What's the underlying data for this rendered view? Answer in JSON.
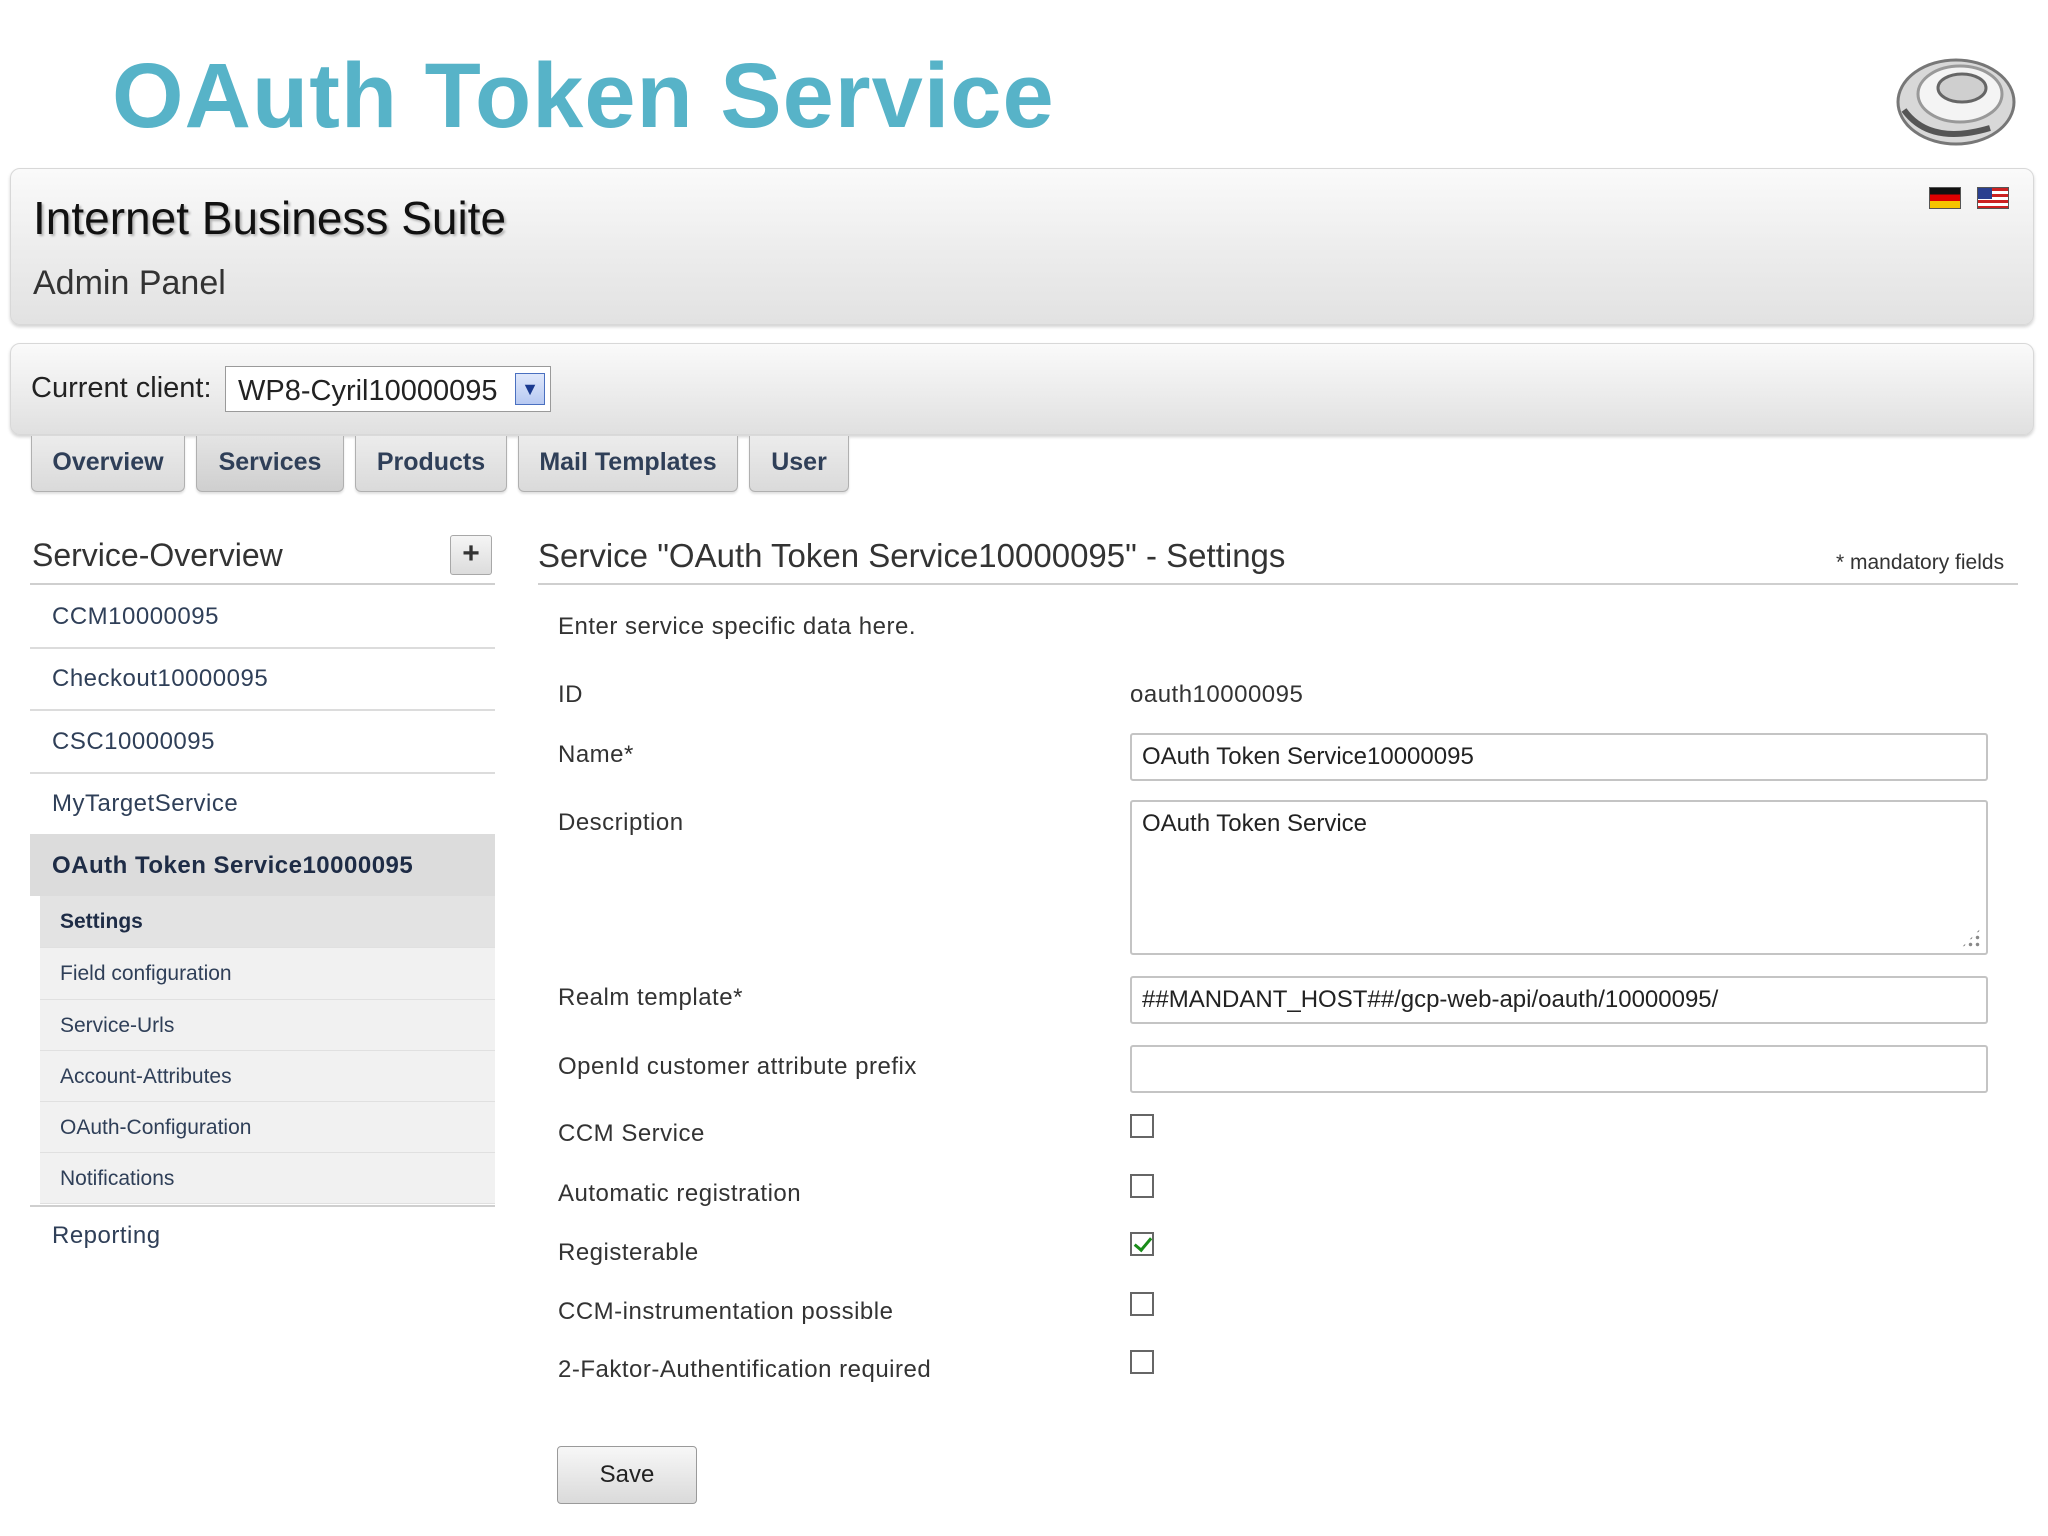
{
  "slide": {
    "title": "OAuth Token Service"
  },
  "header": {
    "title": "Internet Business Suite",
    "subtitle": "Admin Panel"
  },
  "client": {
    "label": "Current client:",
    "selected": "WP8-Cyril10000095"
  },
  "tabs": [
    "Overview",
    "Services",
    "Products",
    "Mail Templates",
    "User"
  ],
  "sidebar": {
    "title": "Service-Overview",
    "add_label": "+",
    "items": [
      "CCM10000095",
      "Checkout10000095",
      "CSC10000095",
      "MyTargetService",
      "OAuth Token Service10000095"
    ],
    "subitems": [
      "Settings",
      "Field configuration",
      "Service-Urls",
      "Account-Attributes",
      "OAuth-Configuration",
      "Notifications"
    ],
    "reporting": "Reporting"
  },
  "main": {
    "title": "Service \"OAuth Token Service10000095\" - Settings",
    "mandatory_note": "* mandatory fields",
    "intro": "Enter service specific data here.",
    "id_label": "ID",
    "id_value": "oauth10000095",
    "name_label": "Name*",
    "name_value": "OAuth Token Service10000095",
    "description_label": "Description",
    "description_value": "OAuth Token Service",
    "realm_label": "Realm template*",
    "realm_value": "##MANDANT_HOST##/gcp-web-api/oauth/10000095/",
    "openid_label": "OpenId customer attribute prefix",
    "openid_value": "",
    "checkboxes": [
      {
        "label": "CCM Service",
        "checked": false
      },
      {
        "label": "Automatic registration",
        "checked": false
      },
      {
        "label": "Registerable",
        "checked": true
      },
      {
        "label": "CCM-instrumentation possible",
        "checked": false
      },
      {
        "label": "2-Faktor-Authentification required",
        "checked": false
      }
    ],
    "save_label": "Save"
  }
}
